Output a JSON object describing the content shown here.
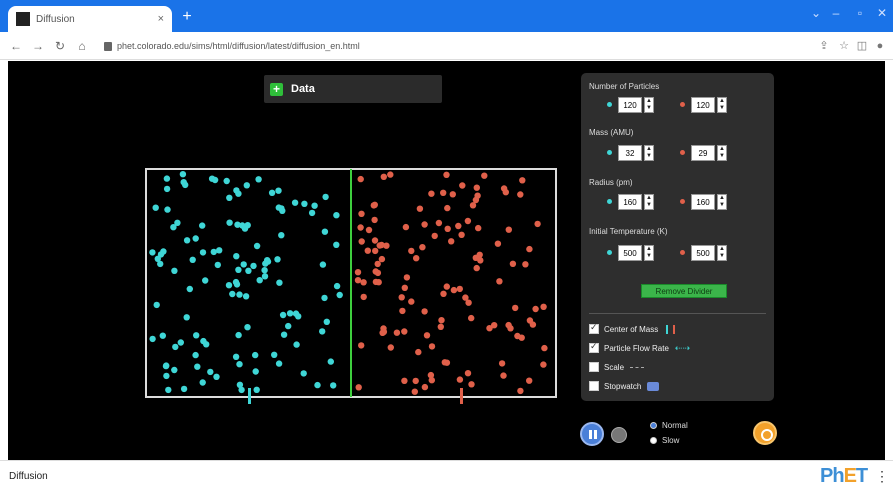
{
  "browser": {
    "tab_title": "Diffusion",
    "tab_close": "×",
    "new_tab": "+",
    "url": "phet.colorado.edu/sims/html/diffusion/latest/diffusion_en.html"
  },
  "sim": {
    "data_label": "Data",
    "panel": {
      "num_particles_label": "Number of Particles",
      "num_left": "120",
      "num_right": "120",
      "mass_label": "Mass (AMU)",
      "mass_left": "32",
      "mass_right": "29",
      "radius_label": "Radius (pm)",
      "radius_left": "160",
      "radius_right": "160",
      "temp_label": "Initial Temperature (K)",
      "temp_left": "500",
      "temp_right": "500",
      "remove_divider": "Remove Divider",
      "center_of_mass": "Center of Mass",
      "particle_flow_rate": "Particle Flow Rate",
      "scale": "Scale",
      "stopwatch": "Stopwatch"
    },
    "speed": {
      "normal": "Normal",
      "slow": "Slow"
    },
    "colors": {
      "left": "#3fd6d6",
      "right": "#e0604a",
      "divider": "#3ecf3e"
    }
  },
  "footer": {
    "title": "Diffusion",
    "logo": "PhET"
  }
}
